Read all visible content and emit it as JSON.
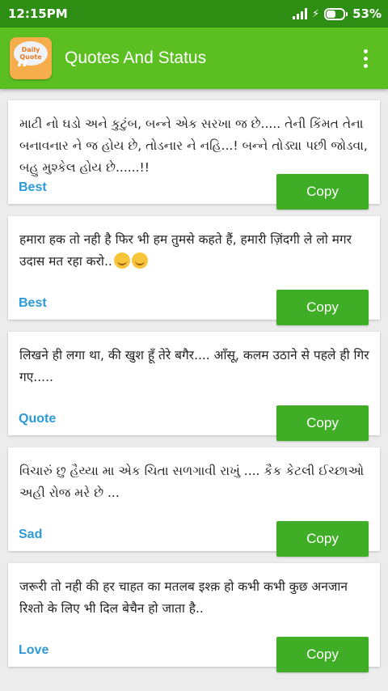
{
  "status": {
    "time": "12:15PM",
    "battery": "53%",
    "battery_level": 0.53
  },
  "app": {
    "title": "Quotes And Status",
    "logo_text": [
      "Daily",
      "Quote"
    ],
    "logo_quote": "“"
  },
  "quotes": [
    {
      "text": "માટી નો ઘડો અને કુટુંબ, બન્ને એક સરખા જ છે..... તેની કિંમત તેના બનાવનાર ને જ હોય છે, તોડનાર ને નહિ...! બન્ને તોડ્યા પછી જોડવા, બહુ મુશ્કેલ હોય છે......!!",
      "category": "Best",
      "copy_label": "Copy"
    },
    {
      "text": "हमारा हक तो नही है फिर भी हम तुमसे कहते हैं, हमारी ज़िंदगी ले लो मगर उदास मत रहा करो..",
      "category": "Best",
      "copy_label": "Copy"
    },
    {
      "text": "लिखने ही लगा था, की खुश हूँ तेरे बगैर.... आँसू, कलम उठाने से पहले ही गिर गए.....",
      "category": "Quote",
      "copy_label": "Copy"
    },
    {
      "text": "વિચારું છુ હૈય્યા મા એક ચિતા સળગાવી રાખું .... કૈક કેટલી ઈચ્છાઓ અહી રોજ મરે છે ...",
      "category": "Sad",
      "copy_label": "Copy"
    },
    {
      "text": "जरूरी तो नही की हर चाहत का मतलब इश्क़ हो कभी कभी कुछ अनजान रिश्तो के लिए भी दिल बेचैन हो जाता है..",
      "category": "Love",
      "copy_label": "Copy"
    }
  ]
}
